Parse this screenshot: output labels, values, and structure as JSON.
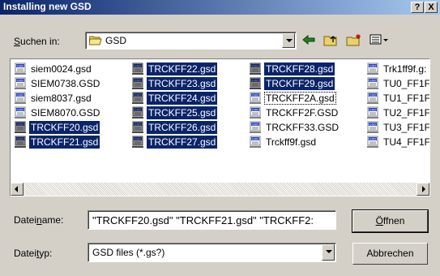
{
  "window": {
    "title": "Installing new GSD"
  },
  "titlebar_buttons": {
    "help": "?",
    "close": "X"
  },
  "lookin": {
    "label_pre": "",
    "label_u": "S",
    "label_post": "uchen in:",
    "folder": "GSD"
  },
  "toolbar": {
    "back_icon": "back-arrow-icon",
    "up_icon": "folder-up-icon",
    "new_icon": "new-folder-icon",
    "view_icon": "view-menu-icon"
  },
  "files": [
    {
      "name": "siem0024.gsd",
      "selected": false
    },
    {
      "name": "SIEM0738.GSD",
      "selected": false
    },
    {
      "name": "siem8037.gsd",
      "selected": false
    },
    {
      "name": "SIEM8070.GSD",
      "selected": false
    },
    {
      "name": "TRCKFF20.gsd",
      "selected": true
    },
    {
      "name": "TRCKFF21.gsd",
      "selected": true
    },
    {
      "name": "TRCKFF22.gsd",
      "selected": true
    },
    {
      "name": "TRCKFF23.gsd",
      "selected": true
    },
    {
      "name": "TRCKFF24.gsd",
      "selected": true
    },
    {
      "name": "TRCKFF25.gsd",
      "selected": true
    },
    {
      "name": "TRCKFF26.gsd",
      "selected": true
    },
    {
      "name": "TRCKFF27.gsd",
      "selected": true
    },
    {
      "name": "TRCKFF28.gsd",
      "selected": true
    },
    {
      "name": "TRCKFF29.gsd",
      "selected": true
    },
    {
      "name": "TRCKFF2A.gsd",
      "selected": false,
      "focused": true
    },
    {
      "name": "TRCKFF2F.GSD",
      "selected": false
    },
    {
      "name": "TRCKFF33.GSD",
      "selected": false
    },
    {
      "name": "Trckff9f.gsd",
      "selected": false
    },
    {
      "name": "Trk1ff9f.g:",
      "selected": false
    },
    {
      "name": "TU0_FF1F",
      "selected": false
    },
    {
      "name": "TU1_FF1F",
      "selected": false
    },
    {
      "name": "TU2_FF1F",
      "selected": false
    },
    {
      "name": "TU3_FF1F",
      "selected": false
    },
    {
      "name": "TU4_FF1F",
      "selected": false
    }
  ],
  "filename": {
    "label_pre": "Datei",
    "label_u": "n",
    "label_post": "ame:",
    "value": "\"TRCKFF20.gsd\" \"TRCKFF21.gsd\" \"TRCKFF2:"
  },
  "filetype": {
    "label_pre": "Datei",
    "label_u": "t",
    "label_post": "yp:",
    "value": "GSD files (*.gs?)"
  },
  "buttons": {
    "open_u": "Ö",
    "open_rest": "ffnen",
    "cancel": "Abbrechen"
  }
}
